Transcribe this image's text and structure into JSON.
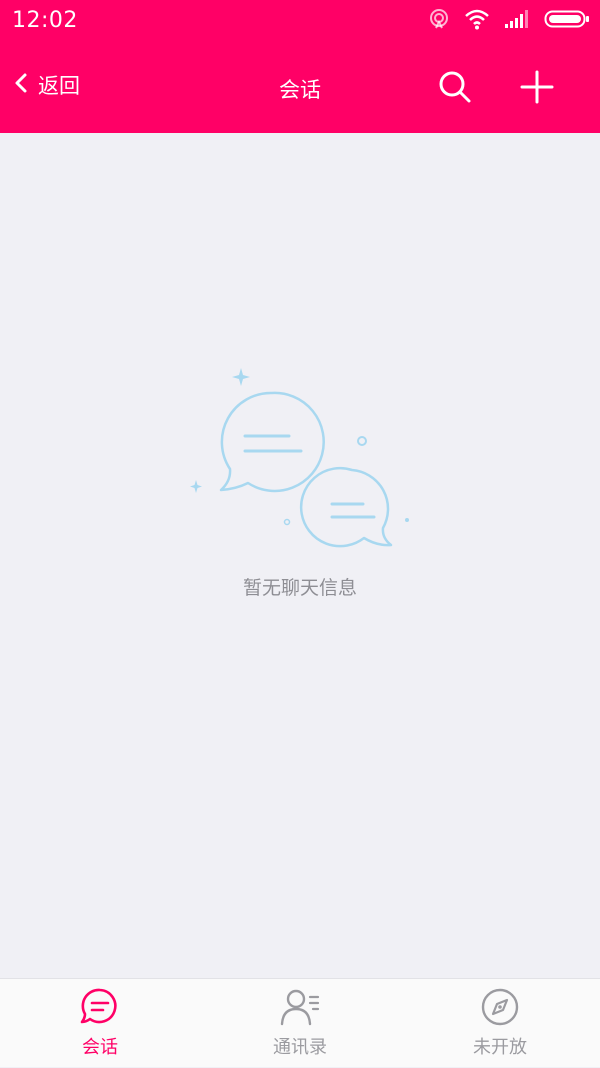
{
  "status_bar": {
    "time": "12:02"
  },
  "header": {
    "back_label": "返回",
    "title": "会话",
    "bg_color": "#ff0066"
  },
  "empty_state": {
    "message": "暂无聊天信息",
    "icon": "chat-bubbles-icon",
    "icon_color": "#a8d8f0"
  },
  "tabs": [
    {
      "label": "会话",
      "icon": "chat-icon",
      "active": true
    },
    {
      "label": "通讯录",
      "icon": "contacts-icon",
      "active": false
    },
    {
      "label": "未开放",
      "icon": "compass-icon",
      "active": false
    }
  ],
  "colors": {
    "accent": "#ff0066",
    "inactive_tab": "#9b9ba0",
    "background": "#f0f0f5"
  }
}
